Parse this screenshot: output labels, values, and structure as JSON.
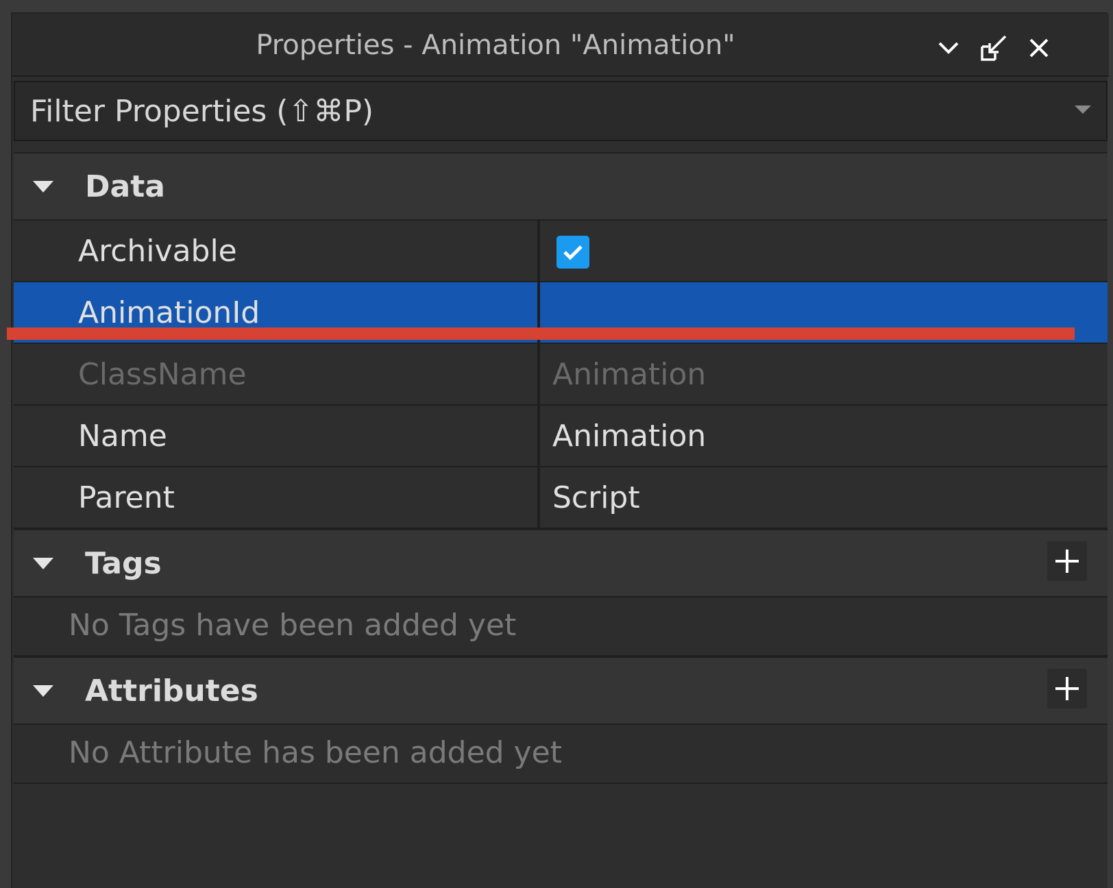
{
  "window": {
    "title": "Properties - Animation \"Animation\""
  },
  "filter": {
    "placeholder": "Filter Properties (⇧⌘P)"
  },
  "sections": {
    "data": {
      "title": "Data",
      "properties": [
        {
          "name": "Archivable",
          "value": "",
          "type": "checkbox",
          "checked": true
        },
        {
          "name": "AnimationId",
          "value": "",
          "selected": true
        },
        {
          "name": "ClassName",
          "value": "Animation",
          "readonly": true
        },
        {
          "name": "Name",
          "value": "Animation"
        },
        {
          "name": "Parent",
          "value": "Script"
        }
      ]
    },
    "tags": {
      "title": "Tags",
      "empty_text": "No Tags have been added yet"
    },
    "attributes": {
      "title": "Attributes",
      "empty_text": "No Attribute has been added yet"
    }
  },
  "colors": {
    "selected_row": "#1557b0",
    "checkbox": "#1b9bf0",
    "annotation_line": "#d64333"
  },
  "icons": {
    "collapse": "chevron-down-icon",
    "undock": "undock-icon",
    "close": "close-icon",
    "add": "plus-icon",
    "section_toggle": "caret-down-icon"
  }
}
